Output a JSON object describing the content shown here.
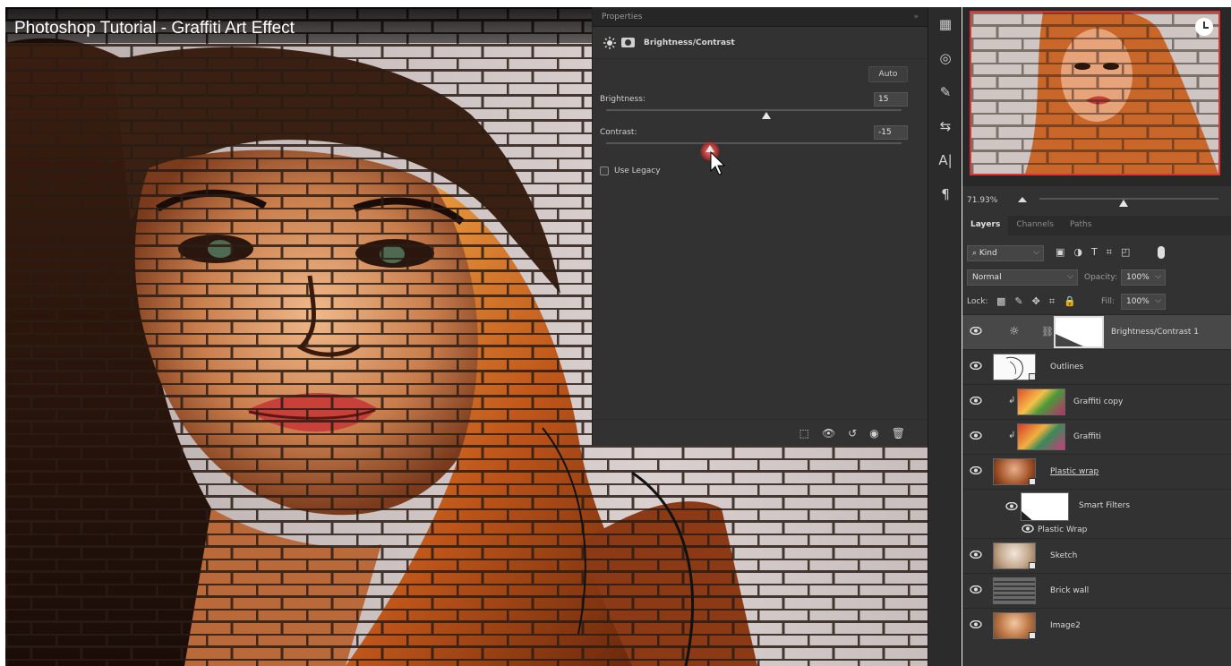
{
  "video": {
    "title": "Photoshop Tutorial - Graffiti Art Effect"
  },
  "properties": {
    "tab_label": "Properties",
    "collapse_glyph": "»",
    "adjustment_title": "Brightness/Contrast",
    "auto_label": "Auto",
    "brightness_label": "Brightness:",
    "brightness_value": "15",
    "contrast_label": "Contrast:",
    "contrast_value": "-15",
    "use_legacy_label": "Use Legacy",
    "use_legacy_checked": false
  },
  "navigator": {
    "zoom": "71.93%"
  },
  "layers_panel": {
    "tabs": [
      {
        "label": "Layers",
        "active": true
      },
      {
        "label": "Channels",
        "active": false
      },
      {
        "label": "Paths",
        "active": false
      }
    ],
    "filter_kind": "Kind",
    "blend_mode": "Normal",
    "opacity_label": "Opacity:",
    "opacity_value": "100%",
    "lock_label": "Lock:",
    "fill_label": "Fill:",
    "fill_value": "100%",
    "layers": [
      {
        "name": "Brightness/Contrast 1"
      },
      {
        "name": "Outlines"
      },
      {
        "name": "Graffiti copy"
      },
      {
        "name": "Graffiti"
      },
      {
        "name": "Plastic wrap"
      },
      {
        "name": "Smart Filters"
      },
      {
        "name": "Plastic Wrap"
      },
      {
        "name": "Sketch"
      },
      {
        "name": "Brick wall"
      },
      {
        "name": "Image2"
      }
    ]
  },
  "colors": {
    "panel_bg": "#323232",
    "dark_bg": "#282828",
    "selected_layer": "#484848",
    "navigator_border": "#dd3333",
    "cursor_highlight": "#e05050"
  }
}
